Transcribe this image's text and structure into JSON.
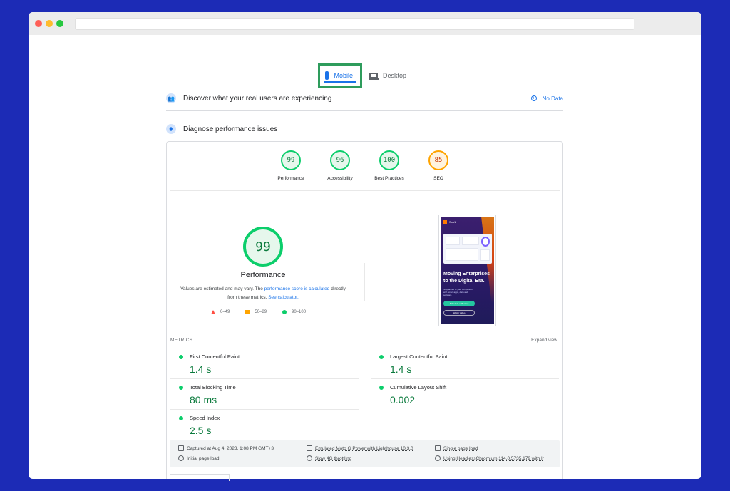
{
  "browser": {
    "url": ""
  },
  "tabs": [
    {
      "label": "Mobile",
      "icon": "phone-icon",
      "active": true
    },
    {
      "label": "Desktop",
      "icon": "laptop-icon",
      "active": false
    }
  ],
  "field_data": {
    "title": "Discover what your real users are experiencing",
    "status": "No Data"
  },
  "diagnose": {
    "title": "Diagnose performance issues"
  },
  "categories": [
    {
      "score": "99",
      "label": "Performance",
      "rating": "good"
    },
    {
      "score": "96",
      "label": "Accessibility",
      "rating": "good"
    },
    {
      "score": "100",
      "label": "Best Practices",
      "rating": "good"
    },
    {
      "score": "85",
      "label": "SEO",
      "rating": "average"
    }
  ],
  "performance": {
    "score": "99",
    "title": "Performance",
    "note_1": "Values are estimated and may vary. The ",
    "note_link_1": "performance score is calculated",
    "note_2": " directly from these metrics. ",
    "note_link_2": "See calculator.",
    "legend": [
      "0–49",
      "50–89",
      "90–100"
    ]
  },
  "screenshot": {
    "brand": "Sou1",
    "headline": "Moving Enterprises to the Digital Era.",
    "subtext": "Stay ahead of your competition with smart apps, data and software.",
    "primary_cta": "Schedule a Meeting",
    "secondary_cta": "Watch Video"
  },
  "metrics": {
    "heading": "METRICS",
    "expand": "Expand view",
    "items": [
      {
        "name": "First Contentful Paint",
        "value": "1.4 s"
      },
      {
        "name": "Largest Contentful Paint",
        "value": "1.4 s"
      },
      {
        "name": "Total Blocking Time",
        "value": "80 ms"
      },
      {
        "name": "Cumulative Layout Shift",
        "value": "0.002"
      },
      {
        "name": "Speed Index",
        "value": "2.5 s"
      }
    ]
  },
  "run_info": {
    "captured": "Captured at Aug 4, 2023, 1:08 PM GMT+3",
    "load": "Initial page load",
    "device": "Emulated Moto G Power with Lighthouse 10.3.0",
    "throttling": "Slow 4G throttling",
    "session": "Single page load",
    "browser": "Using HeadlessChromium 114.0.5735.179 with lr"
  },
  "colors": {
    "good": "#0cce6b",
    "average": "#ffa400",
    "poor": "#ff4e42",
    "accent": "#1a73e8",
    "highlight": "#2e9c5c",
    "background": "#1c2bb6"
  }
}
